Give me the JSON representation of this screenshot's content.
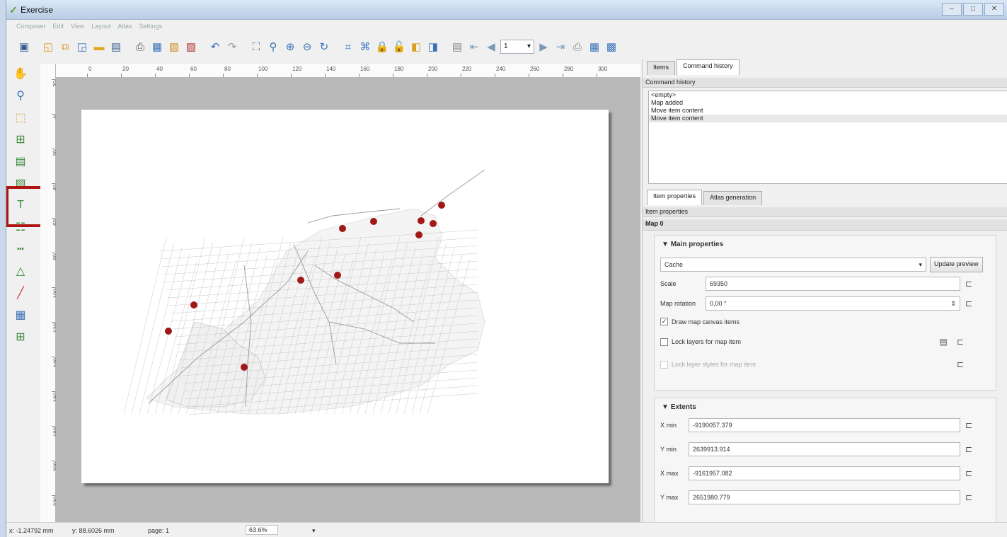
{
  "window": {
    "title": "Exercise",
    "menu": [
      "Composer",
      "Edit",
      "View",
      "Layout",
      "Atlas",
      "Settings"
    ]
  },
  "toolbar": {
    "page_value": "1",
    "icons": [
      "save-icon",
      "new-composer-icon",
      "duplicate-composer-icon",
      "composer-manager-icon",
      "open-template-icon",
      "save-template-icon",
      "print-icon",
      "export-image-icon",
      "export-svg-icon",
      "export-pdf-icon",
      "undo-icon",
      "redo-icon",
      "zoom-full-icon",
      "zoom-100-icon",
      "zoom-in-icon",
      "zoom-out-icon",
      "refresh-icon",
      "group-icon",
      "ungroup-icon",
      "lock-icon",
      "unlock-icon",
      "raise-icon",
      "align-icon",
      "atlas-preview-icon",
      "first-feature-icon",
      "previous-feature-icon",
      "next-feature-icon",
      "last-feature-icon",
      "print-atlas-icon",
      "export-atlas-icon",
      "atlas-settings-icon"
    ]
  },
  "left_tools": [
    "pan-icon",
    "zoom-tool-icon",
    "select-move-icon",
    "move-item-content-icon",
    "add-map-icon",
    "add-image-icon",
    "add-label-icon",
    "add-legend-icon",
    "add-scalebar-icon",
    "add-shape-icon",
    "add-arrow-icon",
    "add-table-icon",
    "add-html-icon"
  ],
  "rulers": {
    "horizontal": [
      "0",
      "20",
      "40",
      "60",
      "80",
      "100",
      "120",
      "140",
      "160",
      "180",
      "200",
      "220",
      "240",
      "260",
      "280",
      "300"
    ],
    "vertical": [
      "20",
      "0",
      "20",
      "40",
      "60",
      "80",
      "100",
      "120",
      "140",
      "160",
      "180",
      "200",
      "220"
    ]
  },
  "status": {
    "x": "x: -1.24792 mm",
    "y": "y: 88.6026 mm",
    "page": "page: 1",
    "zoom": "63.6%"
  },
  "panel": {
    "tabs_top": [
      "Items",
      "Command history"
    ],
    "command_history_header": "Command history",
    "commands": [
      "<empty>",
      "Map added",
      "Move item content",
      "Move item content"
    ],
    "tabs_bottom": [
      "Item properties",
      "Atlas generation"
    ],
    "item_properties_header": "Item properties",
    "item_name": "Map 0",
    "main_properties": {
      "title": "Main properties",
      "preview_mode": "Cache",
      "update_preview": "Update preview",
      "scale_label": "Scale",
      "scale_value": "69350",
      "rotation_label": "Map rotation",
      "rotation_value": "0,00 °",
      "draw_canvas_items": "Draw map canvas items",
      "lock_layers": "Lock layers for map item",
      "lock_styles": "Lock layer styles for map item"
    },
    "extents": {
      "title": "Extents",
      "xmin_label": "X min",
      "xmin": "-9190057.379",
      "ymin_label": "Y min",
      "ymin": "2639913.914",
      "xmax_label": "X max",
      "xmax": "-9161957.082",
      "ymax_label": "Y max",
      "ymax": "2651980.779"
    }
  },
  "colors": {
    "marker": "#a01818",
    "highlight": "#b01515",
    "canvas_bg": "#b9b9b9"
  }
}
